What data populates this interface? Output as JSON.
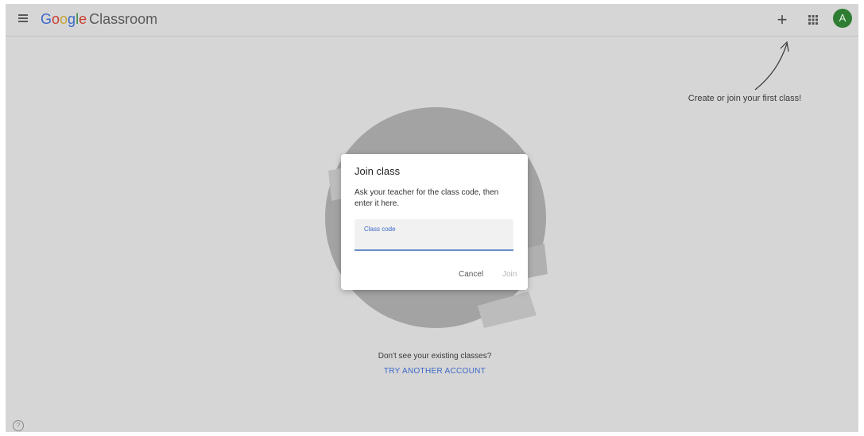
{
  "header": {
    "brand_google": "Google",
    "brand_product": "Classroom",
    "create_icon": "plus-icon",
    "apps_icon": "apps-grid-icon",
    "avatar_initial": "A"
  },
  "hint": {
    "text": "Create or join your first class!"
  },
  "dialog": {
    "title": "Join class",
    "description": "Ask your teacher for the class code, then enter it here.",
    "field_label": "Class code",
    "field_value": "",
    "cancel_label": "Cancel",
    "join_label": "Join"
  },
  "empty_state": {
    "question": "Don't see your existing classes?",
    "action_label": "TRY ANOTHER ACCOUNT"
  },
  "footer": {
    "help_glyph": "?"
  },
  "colors": {
    "brand_blue": "#3c68c8",
    "avatar_green": "#2e7d32",
    "overlay": "#d6d6d6"
  }
}
